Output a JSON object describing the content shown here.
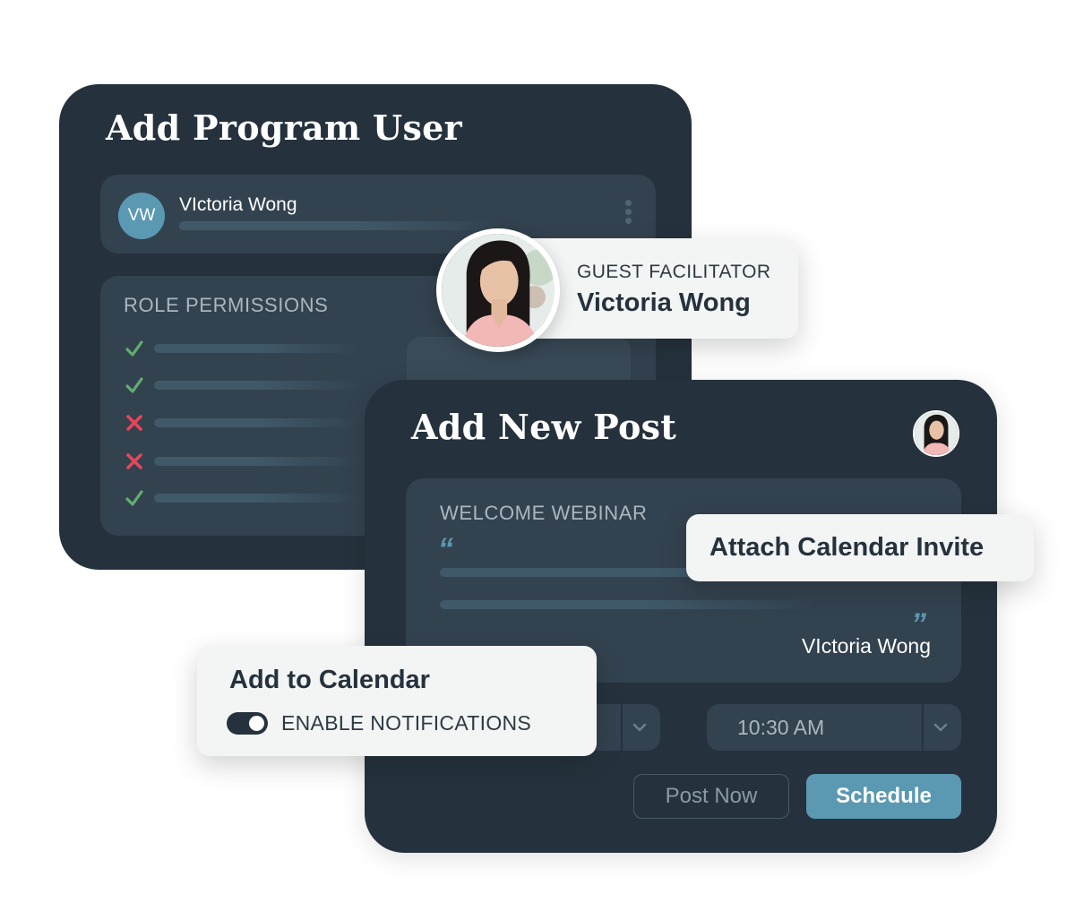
{
  "program_card": {
    "title": "Add Program User",
    "user": {
      "initials": "VW",
      "name": "VIctoria Wong"
    },
    "permissions": {
      "heading": "ROLE PERMISSIONS",
      "items": [
        {
          "status": "allowed"
        },
        {
          "status": "allowed"
        },
        {
          "status": "denied"
        },
        {
          "status": "denied"
        },
        {
          "status": "allowed"
        }
      ]
    }
  },
  "guest_card": {
    "role": "GUEST FACILITATOR",
    "name": "Victoria Wong"
  },
  "post_card": {
    "title": "Add New Post",
    "message": {
      "heading": "WELCOME WEBINAR",
      "open_quote": "“",
      "close_quote": "”",
      "author": "VIctoria Wong"
    },
    "time_value": "10:30 AM",
    "post_now_label": "Post Now",
    "schedule_label": "Schedule"
  },
  "attach_card": {
    "label": "Attach Calendar Invite"
  },
  "calendar_card": {
    "title": "Add to Calendar",
    "toggle_label": "ENABLE NOTIFICATIONS",
    "toggle_on": true
  },
  "colors": {
    "card_bg": "#25323d",
    "panel_bg": "#33424f",
    "accent": "#5b99b2",
    "check": "#5fae6f",
    "cross": "#e8445a",
    "float_bg": "#f3f4f4"
  }
}
